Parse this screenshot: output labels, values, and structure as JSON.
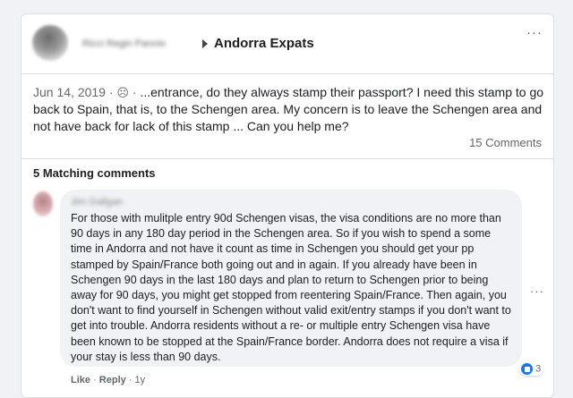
{
  "post": {
    "author": "Ricci Regin Pannio",
    "group": "Andorra Expats",
    "date": "Jun 14, 2019",
    "sep": " · ",
    "privacy_icon": "globe-icon",
    "text": "...entrance, do they always stamp their passport? I need this stamp to go back to Spain, that is, to the Schengen area. My concern is to leave the Schengen area and not have back for lack of this stamp ... Can you help me?",
    "comments_count": "15 Comments",
    "more_label": "···"
  },
  "comments_section": {
    "title": "5 Matching comments"
  },
  "comment": {
    "author": "Jim Gallgan",
    "text": "For those with mulitple entry 90d Schengen visas, the visa conditions are no more than 90 days in any 180 day period in the Schengen area. So if you wish to spend a some time in Andorra and not have it count as time in Schengen you should get your pp stamped by Spain/France both going out and in again. If you already have been in Schengen 90 days in the last 180 days and plan to return to Schengen prior to being away for 90 days, you might get stopped from reentering Spain/France. Then again, you don't want to find yourself in Schengen without valid exit/entry stamps if you don't want to get into trouble. Andorra residents without a re- or multiple entry Schengen visa have been known to be stopped at the Spain/France border. Andorra does not require a visa if your stay is less than 90 days.",
    "reaction_count": "3",
    "like": "Like",
    "reply": "Reply",
    "age": "1y",
    "dot": " · ",
    "more_label": "···"
  },
  "colors": {
    "background": "#f0f2f5",
    "card": "#ffffff",
    "bubble": "#f0f2f5",
    "secondary_text": "#65676b",
    "like_blue": "#1877f2"
  }
}
